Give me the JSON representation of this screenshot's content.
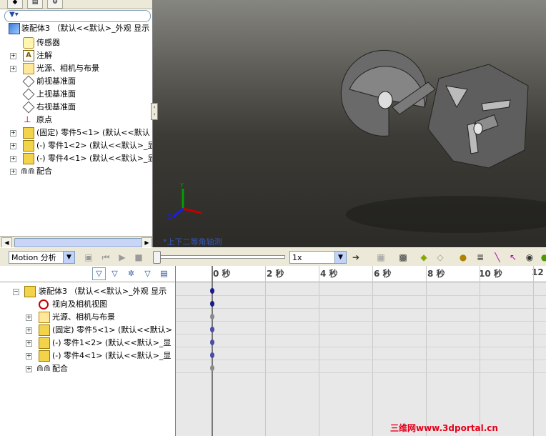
{
  "tree": {
    "tabs": [
      "assembly-tab",
      "property-tab",
      "config-tab"
    ],
    "root_label": "装配体3 （默认<<默认>_外观 显示",
    "items": [
      {
        "label": "传感器",
        "icon": "sensor-icon"
      },
      {
        "label": "注解",
        "icon": "annotation-icon"
      },
      {
        "label": "光源、相机与布景",
        "icon": "lights-cameras-icon"
      },
      {
        "label": "前视基准面",
        "icon": "plane-icon"
      },
      {
        "label": "上视基准面",
        "icon": "plane-icon"
      },
      {
        "label": "右视基准面",
        "icon": "plane-icon"
      },
      {
        "label": "原点",
        "icon": "origin-icon"
      },
      {
        "label": "(固定) 零件5<1> (默认<<默认",
        "icon": "part-icon"
      },
      {
        "label": "(-) 零件1<2> (默认<<默认>_显",
        "icon": "part-icon"
      },
      {
        "label": "(-) 零件4<1> (默认<<默认>_显",
        "icon": "part-icon"
      },
      {
        "label": "配合",
        "icon": "mates-icon"
      }
    ]
  },
  "viewport": {
    "view_label": "*上下二等角轴测"
  },
  "motion": {
    "study_type": "Motion 分析",
    "playback_speed": "1x"
  },
  "motion_tree": {
    "root_label": "装配体3 （默认<<默认>_外观 显示",
    "items": [
      {
        "label": "视向及相机视图",
        "icon": "camera-view-icon"
      },
      {
        "label": "光源、相机与布景",
        "icon": "lights-cameras-icon"
      },
      {
        "label": "(固定) 零件5<1> (默认<<默认>",
        "icon": "part-icon"
      },
      {
        "label": "(-) 零件1<2> (默认<<默认>_显",
        "icon": "part-icon"
      },
      {
        "label": "(-) 零件4<1> (默认<<默认>_显",
        "icon": "part-icon"
      },
      {
        "label": "配合",
        "icon": "mates-icon"
      }
    ]
  },
  "timeline": {
    "tick_labels": [
      "0 秒",
      "2 秒",
      "4 秒",
      "6 秒",
      "8 秒",
      "10 秒",
      "12"
    ]
  },
  "watermark": "三维网www.3dportal.cn",
  "colors": {
    "keyframe": "#1b1b8a",
    "view_label": "#3456b8",
    "watermark": "#e5001a"
  }
}
